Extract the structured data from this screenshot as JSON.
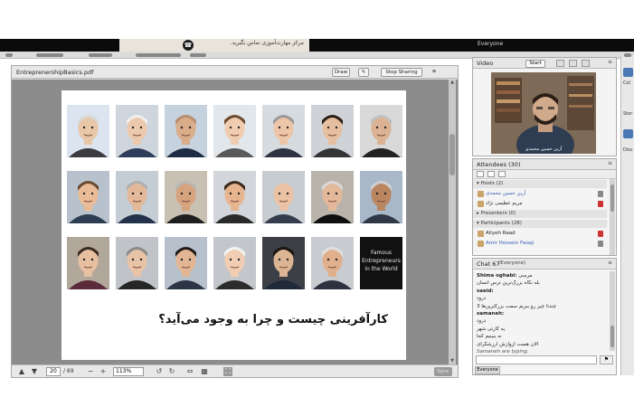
{
  "banner": {
    "ad_text": "مرکز مهارت‌آموزی تماس بگیرید.",
    "everyone_label": "Everyone"
  },
  "share": {
    "title": "EntreprenershipBasics.pdf",
    "draw_label": "Draw",
    "stop_label": "Stop Sharing",
    "slide_heading": "کارآفرینی چیست و چرا به وجود می‌آید؟",
    "text_tile": {
      "line1": "Famous",
      "line2": "Entrepreneurs",
      "line3": "in the World"
    },
    "footer": {
      "page": "20",
      "total": "/ 69",
      "zoom": "113%",
      "sync": "Sync"
    }
  },
  "video": {
    "title": "Video",
    "start_label": "Start",
    "caption": "آرین حسین محمدی"
  },
  "attendees": {
    "title": "Attendees",
    "count": "(30)",
    "rows": [
      {
        "type": "group",
        "label": "▾ Hosts (2)"
      },
      {
        "type": "user",
        "label": "آرین حسین محمدی",
        "link": true,
        "mic": "on"
      },
      {
        "type": "user",
        "label": "مریم عظیمی نژاد",
        "link": false,
        "mic": "off"
      },
      {
        "type": "group",
        "label": "▸ Presenters (0)"
      },
      {
        "type": "group",
        "label": "▾ Participants (28)"
      },
      {
        "type": "user",
        "label": "Aliyeh Raad",
        "link": false,
        "mic": "off"
      },
      {
        "type": "user",
        "label": "Amir Hossein Fasaji",
        "link": true,
        "mic": "on"
      }
    ]
  },
  "chat": {
    "title": "Chat",
    "count": "67",
    "audience": "(Everyone)",
    "lines": [
      {
        "who": "Shima oghabi:",
        "text": "مرسی"
      },
      {
        "who": "",
        "text": "بله نگاه بزرگ‌ترین ترس انسان"
      },
      {
        "who": "saeid:",
        "text": ""
      },
      {
        "who": "",
        "text": "درود"
      },
      {
        "who": "",
        "text": "چندتا چیز رو ببریم سمت بزرگترین‌ها 3"
      },
      {
        "who": "samaneh:",
        "text": ""
      },
      {
        "who": "",
        "text": "درود"
      },
      {
        "who": "",
        "text": "یه کارتی شهر"
      },
      {
        "who": "",
        "text": "نه ببینیم کجا"
      },
      {
        "who": "",
        "text": "الان هست ازوازش ارزشگرای"
      }
    ],
    "typing": "Samaneh are typing.",
    "tab": "Everyone"
  },
  "edge": {
    "label1": "Col",
    "label2": "Ster",
    "label3": "Disc"
  }
}
